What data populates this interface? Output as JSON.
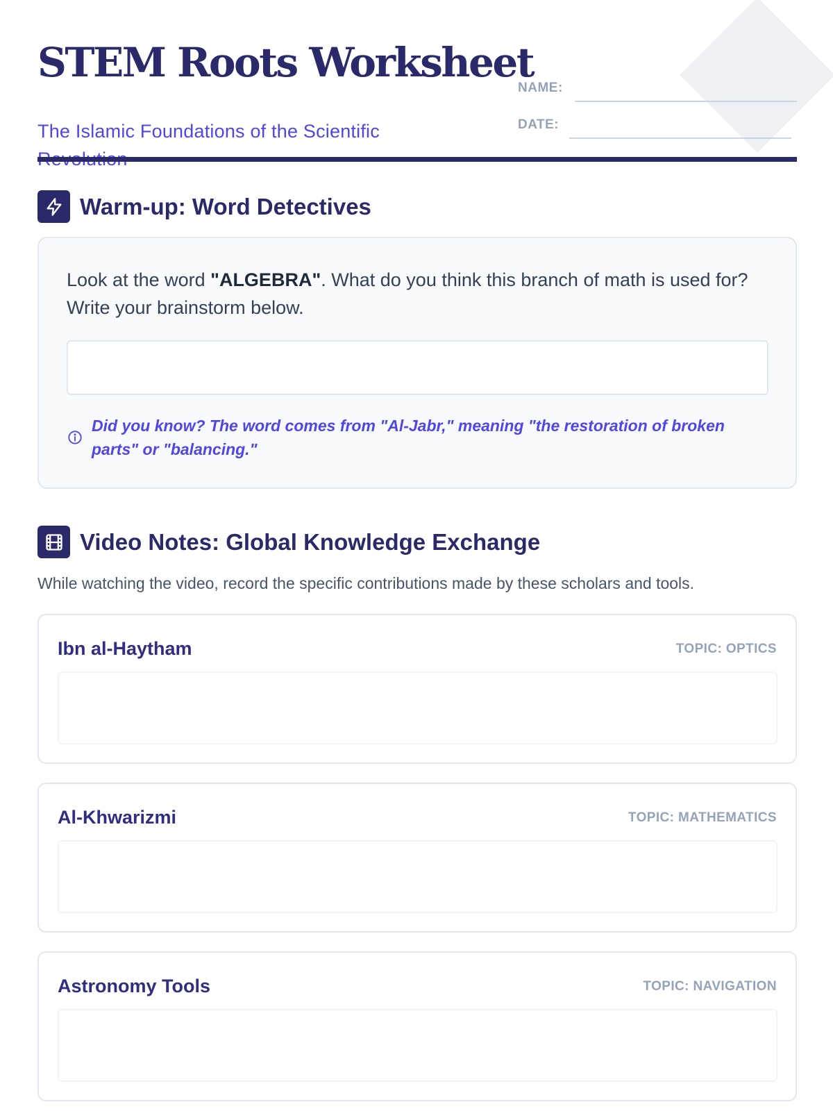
{
  "header": {
    "title": "STEM Roots Worksheet",
    "subtitle": "The Islamic Foundations of the Scientific Revolution",
    "name_label": "NAME:",
    "date_label": "DATE:"
  },
  "warmup": {
    "icon": "lightning-icon",
    "title": "Warm-up: Word Detectives",
    "prompt_before": "Look at the word ",
    "prompt_keyword": "\"ALGEBRA\"",
    "prompt_after": ". What do you think this branch of math is used for? Write your brainstorm below.",
    "info_icon": "info-icon",
    "fact": "Did you know? The word comes from \"Al-Jabr,\" meaning \"the restoration of broken parts\" or \"balancing.\""
  },
  "video": {
    "icon": "film-icon",
    "title": "Video Notes: Global Knowledge Exchange",
    "intro": "While watching the video, record the specific contributions made by these scholars and tools.",
    "cards": [
      {
        "name": "Ibn al-Haytham",
        "topic": "TOPIC: OPTICS"
      },
      {
        "name": "Al-Khwarizmi",
        "topic": "TOPIC: MATHEMATICS"
      },
      {
        "name": "Astronomy Tools",
        "topic": "TOPIC: NAVIGATION"
      }
    ]
  },
  "colors": {
    "navy": "#2a2a6b",
    "indigo": "#4f46e5",
    "muted": "#94a3b8",
    "card_bg": "#f8fafc",
    "border": "#e2e8f0"
  }
}
